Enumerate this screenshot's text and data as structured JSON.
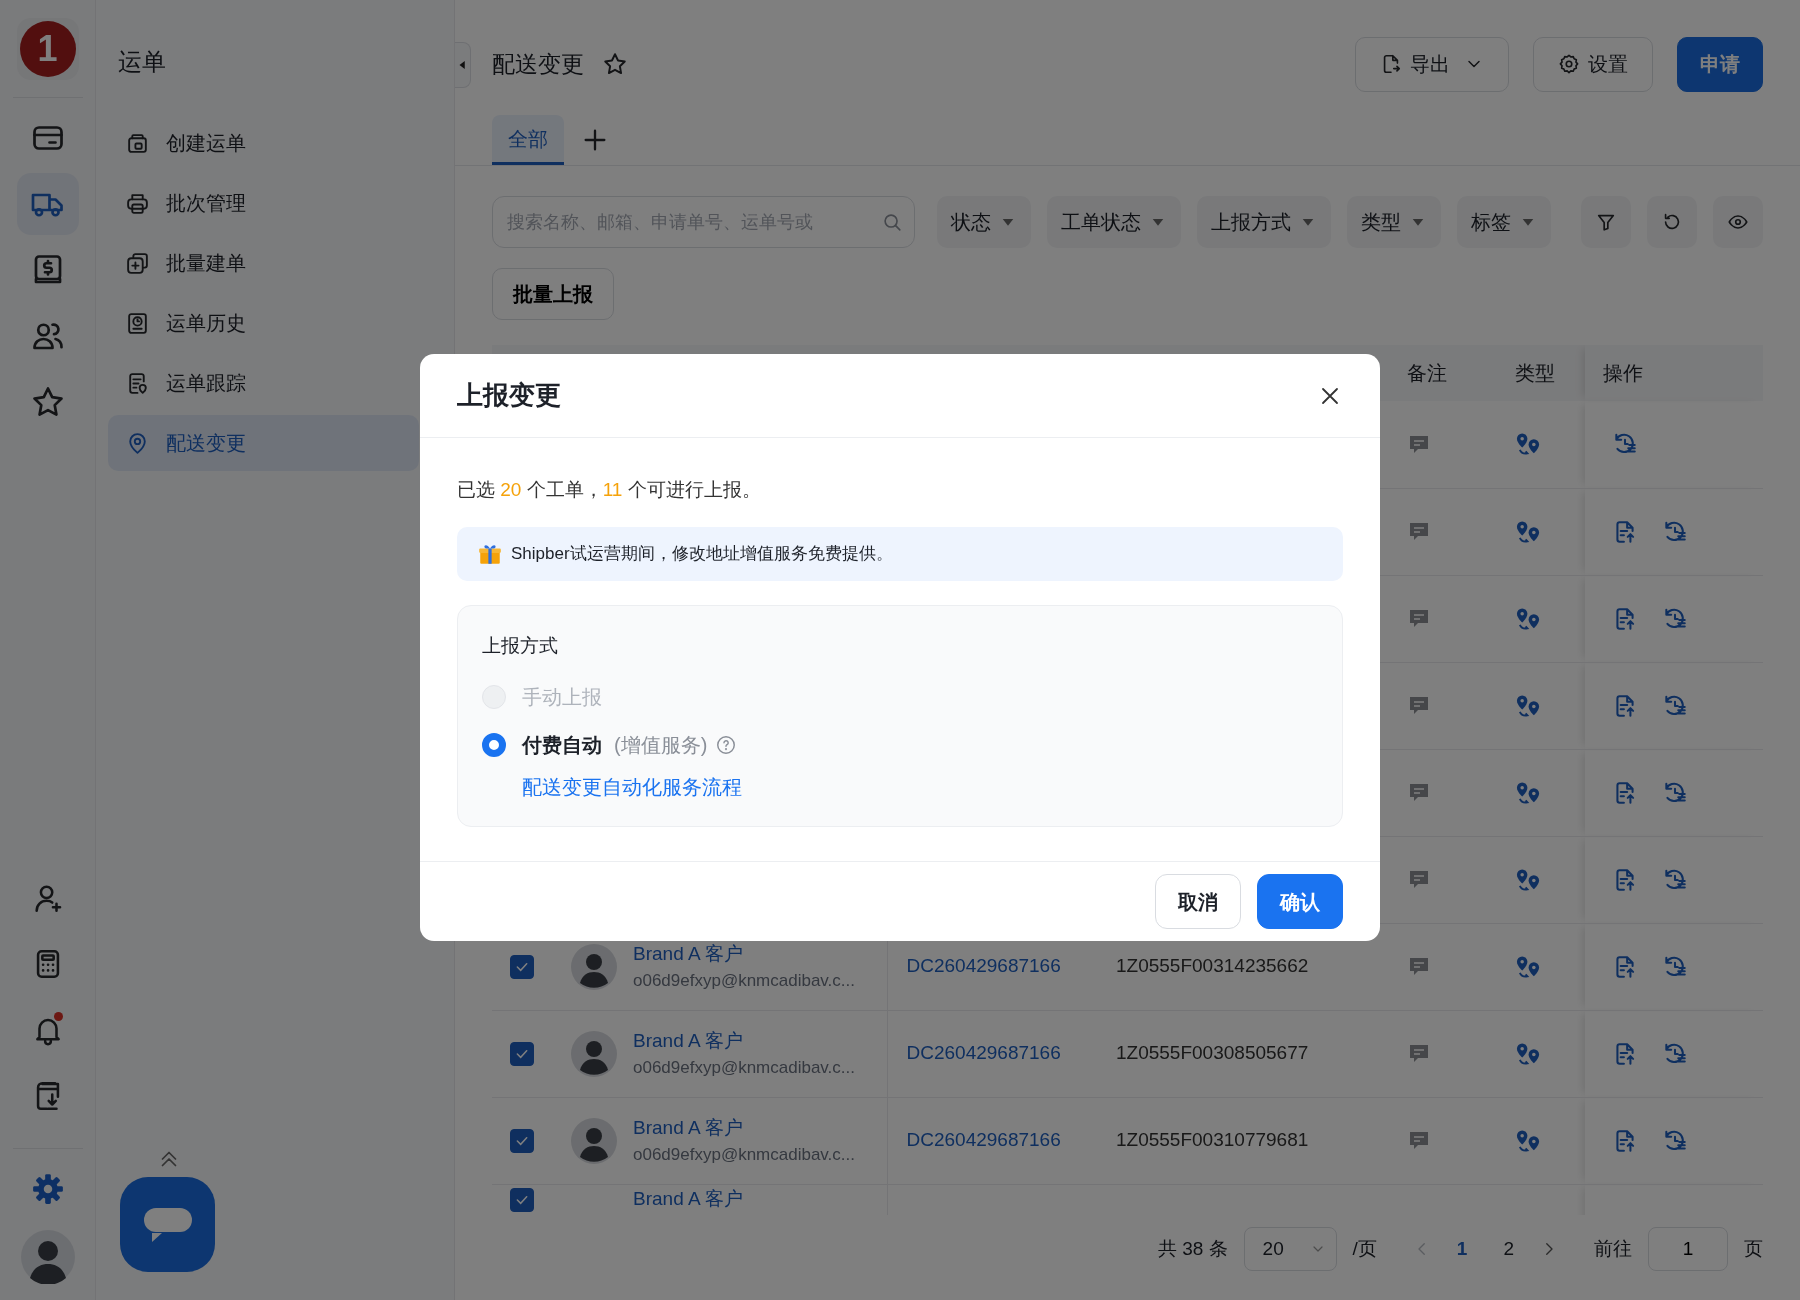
{
  "rail": {
    "logo": "1",
    "items": [
      {
        "kind": "card",
        "selected": false
      },
      {
        "kind": "truck",
        "selected": true
      },
      {
        "kind": "billing",
        "selected": false
      },
      {
        "kind": "people",
        "selected": false
      },
      {
        "kind": "star",
        "selected": false
      }
    ],
    "tools": [
      {
        "kind": "adduser",
        "alert": false
      },
      {
        "kind": "calculator",
        "alert": false
      },
      {
        "kind": "bell",
        "alert": true
      },
      {
        "kind": "download",
        "alert": false
      }
    ]
  },
  "sidebar": {
    "title": "运单",
    "items": [
      {
        "label": "创建运单",
        "kind": "create",
        "selected": false
      },
      {
        "label": "批次管理",
        "kind": "batch",
        "selected": false
      },
      {
        "label": "批量建单",
        "kind": "bulk",
        "selected": false
      },
      {
        "label": "运单历史",
        "kind": "history",
        "selected": false
      },
      {
        "label": "运单跟踪",
        "kind": "tracking",
        "selected": false
      },
      {
        "label": "配送变更",
        "kind": "pin",
        "selected": true
      }
    ]
  },
  "header": {
    "title": "配送变更",
    "buttons": [
      {
        "label": "导出",
        "kind": "export"
      },
      {
        "label": "设置",
        "kind": "settings"
      },
      {
        "label": "申请",
        "kind": "primary"
      }
    ]
  },
  "tabs": [
    {
      "label": "全部",
      "selected": true
    }
  ],
  "filters": {
    "search": {
      "placeholder": "搜索名称、邮箱、申请单号、运单号或"
    },
    "dropdowns": [
      "状态",
      "工单状态",
      "上报方式",
      "类型",
      "标签"
    ]
  },
  "bulk_button": "批量上报",
  "table": {
    "columns": [
      "备注",
      "类型",
      "操作"
    ],
    "rows": [
      {
        "reportable": false
      },
      {
        "reportable": true
      },
      {
        "reportable": true
      },
      {
        "reportable": true
      },
      {
        "reportable": true
      },
      {
        "reportable": true
      },
      {
        "checked": true,
        "customer": "Brand A 客户",
        "email": "o06d9efxyp@knmcadibav.c...",
        "order_no": "DC260429687166",
        "tracking": "1Z0555F00314235662",
        "reportable": true
      },
      {
        "checked": true,
        "customer": "Brand A 客户",
        "email": "o06d9efxyp@knmcadibav.c...",
        "order_no": "DC260429687166",
        "tracking": "1Z0555F00308505677",
        "reportable": true
      },
      {
        "checked": true,
        "customer": "Brand A 客户",
        "email": "o06d9efxyp@knmcadibav.c...",
        "order_no": "DC260429687166",
        "tracking": "1Z0555F00310779681",
        "reportable": true
      },
      {
        "checked": true,
        "customer": "Brand A 客户"
      }
    ]
  },
  "pagination": {
    "total": "共 38 条",
    "page_size": "20",
    "per_page": "/页",
    "pages": [
      {
        "label": "1",
        "selected": true
      },
      {
        "label": "2",
        "selected": false
      }
    ],
    "goto_label": "前往",
    "goto_value": "1",
    "goto_suffix": "页"
  },
  "dialog": {
    "title": "上报变更",
    "summary": {
      "prefix": "已选",
      "selected_count": "20",
      "middle": "个工单，",
      "reportable_count": "11",
      "suffix": "个可进行上报。"
    },
    "notice": "Shipber试运营期间，修改地址增值服务免费提供。",
    "method": {
      "label": "上报方式",
      "options": [
        {
          "label": "手动上报",
          "selected": false,
          "disabled": true
        },
        {
          "label": "付费自动",
          "note": "(增值服务)",
          "link": "配送变更自动化服务流程",
          "selected": true,
          "disabled": false
        }
      ]
    },
    "buttons": [
      {
        "label": "取消",
        "kind": "secondary"
      },
      {
        "label": "确认",
        "kind": "primary"
      }
    ]
  }
}
